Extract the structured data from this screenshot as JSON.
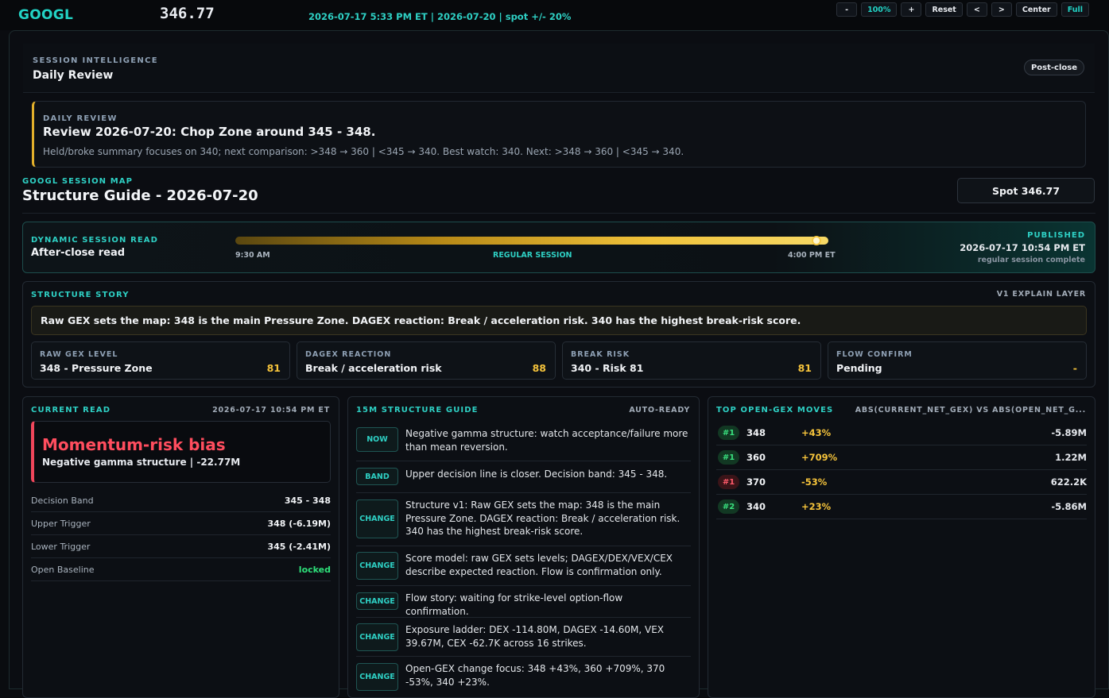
{
  "topbar": {
    "ticker": "GOOGL",
    "price": "346.77",
    "session_info": "2026-07-17 5:33 PM ET | 2026-07-20 | spot +/- 20%",
    "controls": {
      "zoom_out": "-",
      "zoom_level": "100%",
      "zoom_in": "+",
      "reset": "Reset",
      "prev": "<",
      "next": ">",
      "center": "Center",
      "full": "Full"
    }
  },
  "session_intel": {
    "label": "SESSION INTELLIGENCE",
    "title": "Daily Review",
    "status_pill": "Post-close"
  },
  "daily_review": {
    "label": "DAILY REVIEW",
    "title": "Review 2026-07-20: Chop Zone around 345 - 348.",
    "summary": "Held/broke summary focuses on 340; next comparison: >348 → 360 | <345 → 340. Best watch: 340. Next: >348 → 360 | <345 → 340."
  },
  "session_map": {
    "label": "GOOGL SESSION MAP",
    "title": "Structure Guide - 2026-07-20",
    "spot": "Spot 346.77"
  },
  "dynamic_read": {
    "label": "DYNAMIC SESSION READ",
    "title": "After-close read",
    "start_time": "9:30 AM",
    "session_label": "REGULAR SESSION",
    "end_time": "4:00 PM ET",
    "progress_fraction": 0.98,
    "published_label": "PUBLISHED",
    "published_date": "2026-07-17 10:54 PM ET",
    "published_status": "regular session complete"
  },
  "structure_story": {
    "label": "STRUCTURE STORY",
    "layer": "V1 EXPLAIN LAYER",
    "banner": "Raw GEX sets the map: 348 is the main Pressure Zone. DAGEX reaction: Break / acceleration risk. 340 has the highest break-risk score.",
    "cards": [
      {
        "label": "RAW GEX LEVEL",
        "value": "348 - Pressure Zone",
        "score": "81"
      },
      {
        "label": "DAGEX REACTION",
        "value": "Break / acceleration risk",
        "score": "88"
      },
      {
        "label": "BREAK RISK",
        "value": "340 - Risk 81",
        "score": "81"
      },
      {
        "label": "FLOW CONFIRM",
        "value": "Pending",
        "score": "-"
      }
    ]
  },
  "current_read": {
    "label": "CURRENT READ",
    "timestamp": "2026-07-17 10:54 PM ET",
    "bias": "Momentum-risk bias",
    "sub": "Negative gamma structure | -22.77M",
    "rows": [
      {
        "key": "Decision Band",
        "value": "345 - 348"
      },
      {
        "key": "Upper Trigger",
        "value": "348 (-6.19M)"
      },
      {
        "key": "Lower Trigger",
        "value": "345 (-2.41M)"
      },
      {
        "key": "Open Baseline",
        "value": "locked"
      }
    ]
  },
  "guide": {
    "label": "15M STRUCTURE GUIDE",
    "status": "AUTO-READY",
    "items": [
      {
        "tag": "NOW",
        "text": "Negative gamma structure: watch acceptance/failure more than mean reversion."
      },
      {
        "tag": "BAND",
        "text": "Upper decision line is closer. Decision band: 345 - 348."
      },
      {
        "tag": "CHANGE",
        "text": "Structure v1: Raw GEX sets the map: 348 is the main Pressure Zone. DAGEX reaction: Break / acceleration risk. 340 has the highest break-risk score."
      },
      {
        "tag": "CHANGE",
        "text": "Score model: raw GEX sets levels; DAGEX/DEX/VEX/CEX describe expected reaction. Flow is confirmation only."
      },
      {
        "tag": "CHANGE",
        "text": "Flow story: waiting for strike-level option-flow confirmation."
      },
      {
        "tag": "CHANGE",
        "text": "Exposure ladder: DEX -114.80M, DAGEX -14.60M, VEX 39.67M, CEX -62.7K across 16 strikes."
      },
      {
        "tag": "CHANGE",
        "text": "Open-GEX change focus: 348 +43%, 360 +709%, 370 -53%, 340 +23%."
      }
    ]
  },
  "top_moves": {
    "label": "TOP OPEN-GEX MOVES",
    "formula": "ABS(CURRENT_NET_GEX) VS ABS(OPEN_NET_G...",
    "rows": [
      {
        "rank": "#1",
        "strike": "348",
        "change": "+43%",
        "net": "-5.89M",
        "tone": "g"
      },
      {
        "rank": "#1",
        "strike": "360",
        "change": "+709%",
        "net": "1.22M",
        "tone": "g"
      },
      {
        "rank": "#1",
        "strike": "370",
        "change": "-53%",
        "net": "622.2K",
        "tone": "r"
      },
      {
        "rank": "#2",
        "strike": "340",
        "change": "+23%",
        "net": "-5.86M",
        "tone": "g"
      }
    ]
  },
  "colors": {
    "accent": "#22d3c5",
    "warning": "#f5c33b",
    "danger": "#ff4d5e",
    "positive": "#2ee07a"
  }
}
